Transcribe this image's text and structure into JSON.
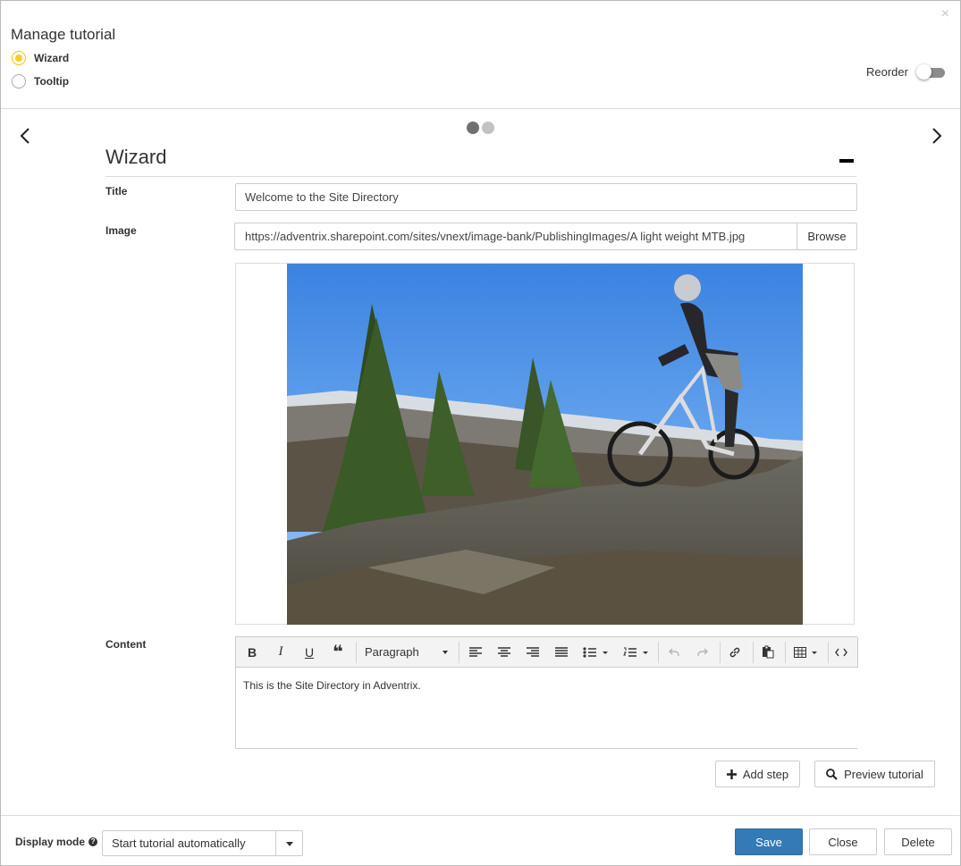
{
  "dialog": {
    "title": "Manage tutorial",
    "close_icon": "×"
  },
  "mode": {
    "options": [
      {
        "label": "Wizard",
        "selected": true
      },
      {
        "label": "Tooltip",
        "selected": false
      }
    ]
  },
  "reorder": {
    "label": "Reorder",
    "on": false
  },
  "carousel": {
    "total_steps": 2,
    "current_step": 1
  },
  "step": {
    "heading": "Wizard",
    "title_label": "Title",
    "title_value": "Welcome to the Site Directory",
    "image_label": "Image",
    "image_url": "https://adventrix.sharepoint.com/sites/vnext/image-bank/PublishingImages/A light weight MTB.jpg",
    "browse_label": "Browse",
    "content_label": "Content",
    "content_text": "This is the Site Directory in Adventrix.",
    "format_select": "Paragraph"
  },
  "toolbar": {
    "buttons": [
      "bold-icon",
      "italic-icon",
      "underline-icon",
      "blockquote-icon",
      "align-left-icon",
      "align-center-icon",
      "align-right-icon",
      "align-justify-icon",
      "bullet-list-icon",
      "numbered-list-icon",
      "undo-icon",
      "redo-icon",
      "link-icon",
      "paste-icon",
      "table-icon",
      "source-code-icon"
    ],
    "bold_glyph": "B",
    "italic_glyph": "I",
    "underline_glyph": "U",
    "quote_glyph": "❝"
  },
  "actions": {
    "add_step": "Add step",
    "preview": "Preview tutorial"
  },
  "footer": {
    "display_mode_label": "Display mode",
    "help_glyph": "?",
    "display_mode_value": "Start tutorial automatically",
    "save": "Save",
    "close": "Close",
    "delete": "Delete"
  },
  "colors": {
    "accent_radio": "#f5cf25",
    "primary_button": "#337ab7",
    "dot_active": "#707070",
    "dot_inactive": "#c3c3c3"
  }
}
